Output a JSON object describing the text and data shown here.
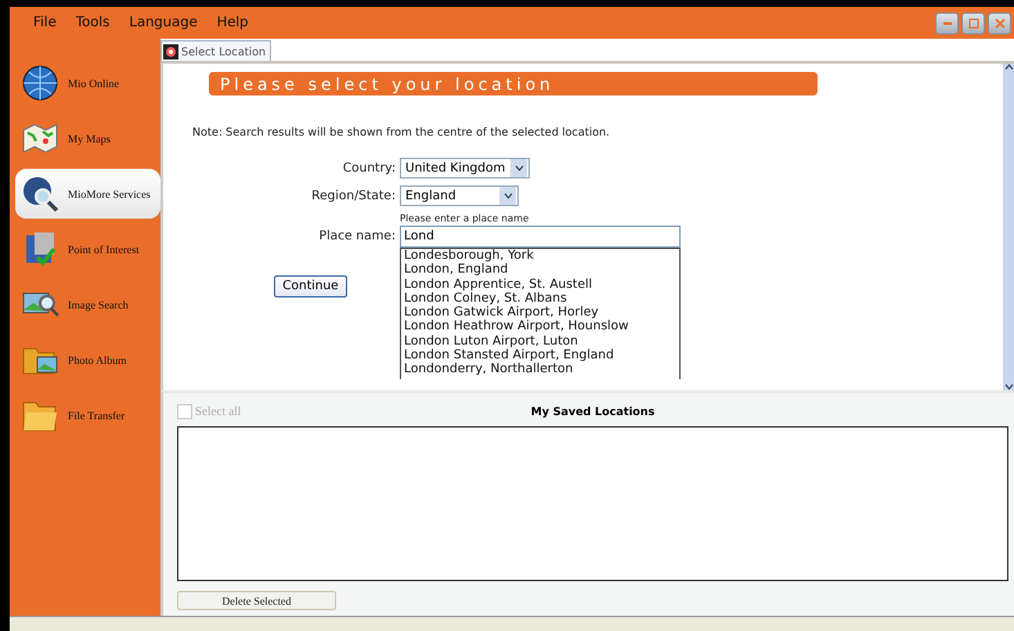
{
  "menu": [
    "File",
    "Tools",
    "Language",
    "Help"
  ],
  "sidebar": {
    "items": [
      {
        "label": "Mio Online",
        "selected": false,
        "kind": "globe"
      },
      {
        "label": "My Maps",
        "selected": false,
        "kind": "map"
      },
      {
        "label": "MioMore Services",
        "selected": true,
        "kind": "magnifier"
      },
      {
        "label": "Point of Interest",
        "selected": false,
        "kind": "poi"
      },
      {
        "label": "Image Search",
        "selected": false,
        "kind": "imagesearch"
      },
      {
        "label": "Photo Album",
        "selected": false,
        "kind": "album"
      },
      {
        "label": "File Transfer",
        "selected": false,
        "kind": "folder"
      }
    ]
  },
  "tab": {
    "label": "Select Location"
  },
  "header": "Please select your location",
  "note": "Note: Search results will be shown from the centre of the selected location.",
  "country": {
    "label": "Country:",
    "value": "United Kingdom"
  },
  "region": {
    "label": "Region/State:",
    "value": "England"
  },
  "place": {
    "hint": "Please enter a place name",
    "label": "Place name:",
    "value": "Lond"
  },
  "suggestions": [
    "Londesborough, York",
    "London, England",
    "London Apprentice, St. Austell",
    "London Colney, St. Albans",
    "London Gatwick Airport, Horley",
    "London Heathrow Airport, Hounslow",
    "London Luton Airport, Luton",
    "London Stansted Airport, England",
    "Londonderry, Northallerton"
  ],
  "continue_button": "Continue",
  "saved": {
    "select_all": {
      "label": "Select all",
      "checked": false,
      "disabled": true
    },
    "title": "My Saved Locations",
    "delete_button": "Delete Selected"
  }
}
